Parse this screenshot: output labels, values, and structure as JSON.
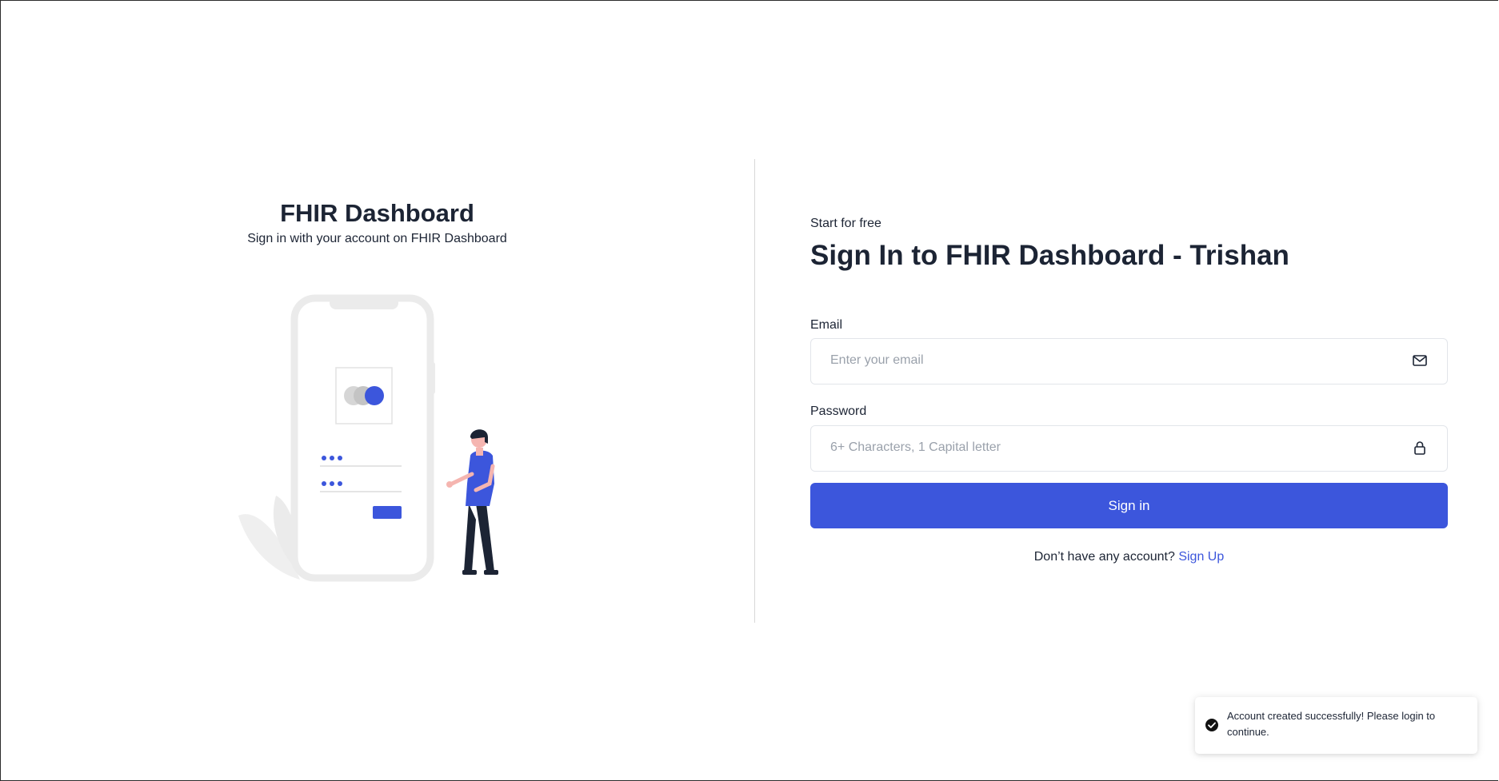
{
  "branding": {
    "title": "FHIR Dashboard",
    "subtitle": "Sign in with your account on FHIR Dashboard",
    "accent_color": "#3c56dc"
  },
  "form": {
    "eyebrow": "Start for free",
    "heading": "Sign In to FHIR Dashboard - Trishan",
    "email": {
      "label": "Email",
      "placeholder": "Enter your email",
      "value": "",
      "icon": "envelope-icon"
    },
    "password": {
      "label": "Password",
      "placeholder": "6+ Characters, 1 Capital letter",
      "value": "",
      "icon": "lock-icon"
    },
    "submit_label": "Sign in",
    "signup_prompt": "Don’t have any account?",
    "signup_link": "Sign Up"
  },
  "toast": {
    "icon": "check-circle-icon",
    "message": "Account created successfully! Please login to continue."
  }
}
